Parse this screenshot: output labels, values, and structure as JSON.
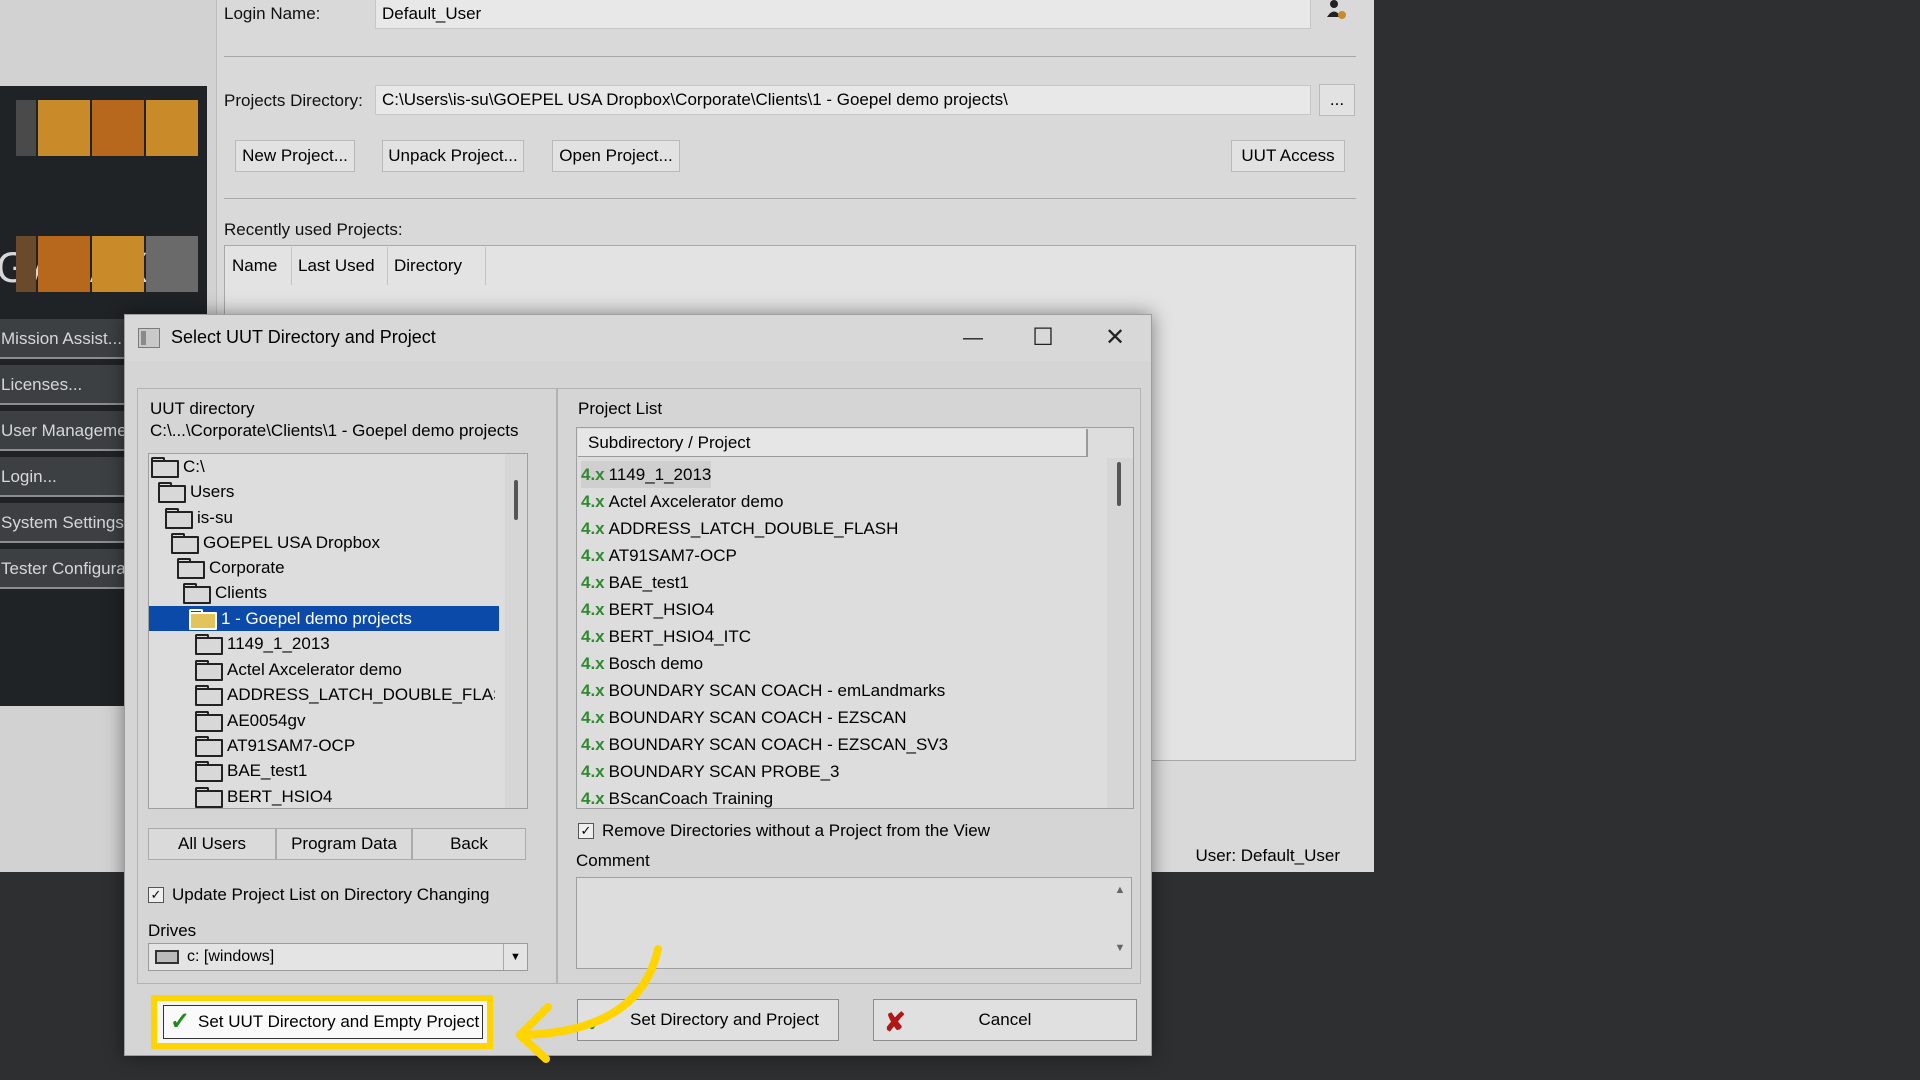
{
  "main_window": {
    "login_label": "Login Name:",
    "login_value": "Default_User",
    "projects_dir_label": "Projects Directory:",
    "projects_dir_value": "C:\\Users\\is-su\\GOEPEL USA Dropbox\\Corporate\\Clients\\1 - Goepel demo projects\\",
    "browse_label": "...",
    "buttons": {
      "new_project": "New Project...",
      "unpack_project": "Unpack Project...",
      "open_project": "Open Project...",
      "uut_access": "UUT Access"
    },
    "recent_label": "Recently used Projects:",
    "recent_columns": [
      "Name",
      "Last Used",
      "Directory"
    ],
    "logo_text": "GALAXY",
    "menu": [
      "Mission Assist...",
      "Licenses...",
      "User Management",
      "Login...",
      "System Settings",
      "Tester Configuration"
    ],
    "status": "User: Default_User",
    "colors": {
      "logo_orange": "#b8681c",
      "logo_orange_light": "#c98a2a",
      "logo_gray": "#6a6a6a"
    }
  },
  "dialog": {
    "title": "Select UUT Directory and Project",
    "window_controls": {
      "minimize": "—",
      "maximize": "☐",
      "close": "✕"
    },
    "uut_directory_label": "UUT directory",
    "uut_directory_path": "C:\\...\\Corporate\\Clients\\1 - Goepel demo projects",
    "tree": [
      "C:\\",
      "Users",
      "is-su",
      "GOEPEL USA Dropbox",
      "Corporate",
      "Clients",
      "1 - Goepel demo projects",
      "1149_1_2013",
      "Actel Axcelerator demo",
      "ADDRESS_LATCH_DOUBLE_FLASH",
      "AE0054gv",
      "AT91SAM7-OCP",
      "BAE_test1",
      "BERT_HSIO4"
    ],
    "selected_tree_item": "1 - Goepel demo projects",
    "location_buttons": [
      "All Users",
      "Program Data",
      "Back"
    ],
    "update_checkbox_label": "Update Project List on Directory Changing",
    "update_checked": true,
    "drives_label": "Drives",
    "drive_value": "c: [windows]",
    "project_list_label": "Project List",
    "project_list_header": "Subdirectory / Project",
    "version_tag": "4.x",
    "projects": [
      "1149_1_2013",
      "Actel Axcelerator demo",
      "ADDRESS_LATCH_DOUBLE_FLASH",
      "AT91SAM7-OCP",
      "BAE_test1",
      "BERT_HSIO4",
      "BERT_HSIO4_ITC",
      "Bosch demo",
      "BOUNDARY SCAN COACH - emLandmarks",
      "BOUNDARY SCAN COACH - EZSCAN",
      "BOUNDARY SCAN COACH - EZSCAN_SV3",
      "BOUNDARY SCAN PROBE_3",
      "BScanCoach Training"
    ],
    "remove_checkbox_label": "Remove Directories without a Project from the View",
    "remove_checked": true,
    "comment_label": "Comment",
    "buttons": {
      "set_uut_empty": "Set UUT Directory and Empty Project",
      "set_dir_project": "Set Directory and Project",
      "cancel": "Cancel"
    },
    "highlight_color": "#ffd400"
  }
}
